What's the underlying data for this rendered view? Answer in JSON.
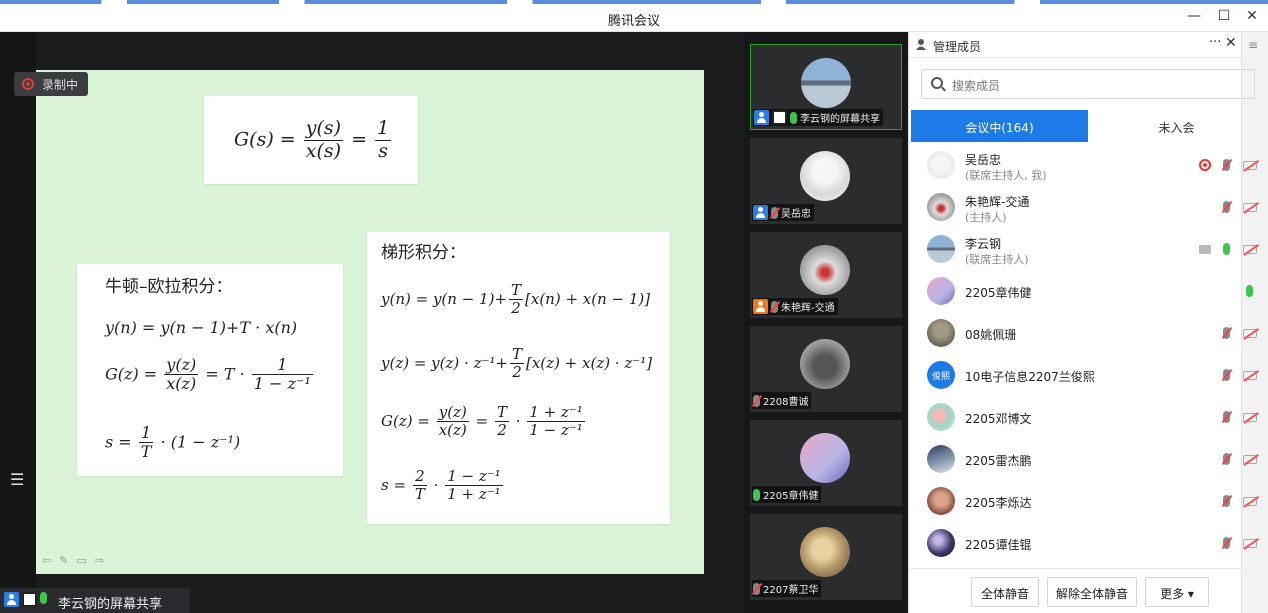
{
  "window": {
    "title": "腾讯会议"
  },
  "stage": {
    "recording_label": "录制中",
    "share_label": "李云钢的屏幕共享",
    "slide": {
      "formula_top": "G(s) = y(s)/x(s) = 1/s",
      "euler": {
        "heading": "牛顿–欧拉积分：",
        "eq1": "y(n) = y(n − 1)+T · x(n)",
        "eq2_lhs": "G(z) =",
        "eq2_frac_num": "y(z)",
        "eq2_frac_den": "x(z)",
        "eq2_mid": "= T ·",
        "eq2_frac2_num": "1",
        "eq2_frac2_den": "1 − z⁻¹",
        "eq3_lhs": "s =",
        "eq3_frac_num": "1",
        "eq3_frac_den": "T",
        "eq3_rhs": "· (1 − z⁻¹)"
      },
      "trap": {
        "heading": "梯形积分：",
        "eq1_lhs": "y(n) = y(n − 1)+",
        "eq1_frac_num": "T",
        "eq1_frac_den": "2",
        "eq1_rhs": "[x(n) + x(n − 1)]",
        "eq2_lhs": "y(z) = y(z) · z⁻¹+",
        "eq2_frac_num": "T",
        "eq2_frac_den": "2",
        "eq2_rhs": "[x(z) + x(z) · z⁻¹]",
        "eq3_lhs": "G(z) =",
        "eq3_f1_num": "y(z)",
        "eq3_f1_den": "x(z)",
        "eq3_eq": "=",
        "eq3_f2_num": "T",
        "eq3_f2_den": "2",
        "eq3_dot": "·",
        "eq3_f3_num": "1 + z⁻¹",
        "eq3_f3_den": "1 − z⁻¹",
        "eq4_lhs": "s =",
        "eq4_f1_num": "2",
        "eq4_f1_den": "T",
        "eq4_dot": "·",
        "eq4_f2_num": "1 − z⁻¹",
        "eq4_f2_den": "1 + z⁻¹"
      }
    }
  },
  "video_tiles": [
    {
      "label": "李云钢的屏幕共享",
      "mic": "on",
      "highlight": true
    },
    {
      "label": "吴岳忠",
      "mic": "off"
    },
    {
      "label": "朱艳辉-交通",
      "mic": "off"
    },
    {
      "label": "2208曹诚",
      "mic": "off"
    },
    {
      "label": "2205章伟健",
      "mic": "on"
    },
    {
      "label": "2207蔡卫华",
      "mic": "off"
    }
  ],
  "panel": {
    "title": "管理成员",
    "more": "···",
    "close": "✕",
    "search_placeholder": "搜索成员",
    "tab_in": "会议中(164)",
    "tab_out": "未入会",
    "members": [
      {
        "name": "吴岳忠",
        "role": "(联席主持人, 我)",
        "recording": true,
        "mic": "off",
        "cam": "off"
      },
      {
        "name": "朱艳辉-交通",
        "role": "(主持人)",
        "mic": "off",
        "cam": "off"
      },
      {
        "name": "李云钢",
        "role": "(联席主持人)",
        "screen": true,
        "mic": "on",
        "cam": "off"
      },
      {
        "name": "2205章伟健",
        "mic": "on"
      },
      {
        "name": "08姚佩珊",
        "mic": "off",
        "cam": "off"
      },
      {
        "name": "10电子信息2207兰俊熙",
        "avatar_text": "俊熙",
        "mic": "off",
        "cam": "off"
      },
      {
        "name": "2205邓博文",
        "mic": "off",
        "cam": "off"
      },
      {
        "name": "2205雷杰鹏",
        "mic": "off",
        "cam": "off"
      },
      {
        "name": "2205李烁达",
        "mic": "off",
        "cam": "off"
      },
      {
        "name": "2205谭佳锟",
        "mic": "off",
        "cam": "off"
      }
    ],
    "btn_mute_all": "全体静音",
    "btn_unmute_all": "解除全体静音",
    "btn_more": "更多 ▾"
  },
  "colors": {
    "accent": "#1d7be8",
    "slide_bg": "#d9f4d6",
    "mic_on": "#3fc450",
    "rec": "#e33"
  }
}
